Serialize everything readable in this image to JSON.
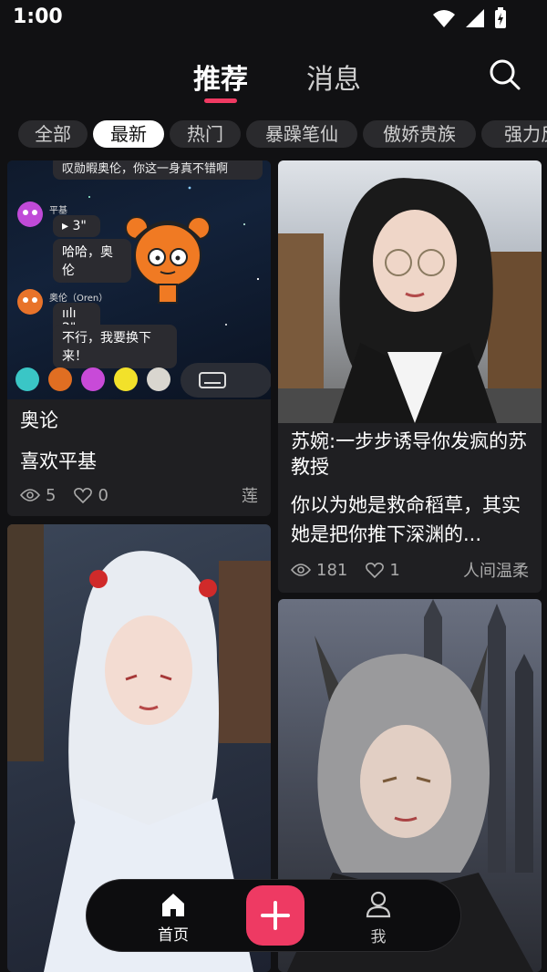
{
  "status_bar": {
    "time": "1:00"
  },
  "header": {
    "tabs": [
      {
        "label": "推荐",
        "active": true
      },
      {
        "label": "消息",
        "active": false
      }
    ]
  },
  "categories": [
    {
      "label": "全部",
      "active": false
    },
    {
      "label": "最新",
      "active": true
    },
    {
      "label": "热门",
      "active": false
    },
    {
      "label": "暴躁笔仙",
      "active": false
    },
    {
      "label": "傲娇贵族",
      "active": false
    },
    {
      "label": "强力反",
      "active": false
    }
  ],
  "cards": [
    {
      "title": "奥论",
      "description": "喜欢平基",
      "views": "5",
      "likes": "0",
      "author": "莲",
      "preview": {
        "top_text": "叹勋暇奥伦，你这一身真不错啊",
        "user1_name": "平基",
        "user1_voice": "▸ 3\"",
        "user1_text": "哈哈，奥伦",
        "user2_name": "奥伦（Oren）",
        "user2_voice": "ıılı 2\"",
        "user2_text": "不行，我要换下来！"
      }
    },
    {
      "title": "苏婉:一步步诱导你发疯的苏教授",
      "description": "你以为她是救命稻草，其实她是把你推下深渊的...",
      "views": "181",
      "likes": "1",
      "author": "人间温柔"
    },
    {
      "title": "",
      "description": "",
      "views": "",
      "likes": "",
      "author": ""
    },
    {
      "title": "",
      "description": "",
      "views": "",
      "likes": "",
      "author": ""
    }
  ],
  "bottom_nav": {
    "home_label": "首页",
    "me_label": "我"
  },
  "colors": {
    "accent": "#ee3a63",
    "background": "#111113",
    "card": "#1f1f22"
  }
}
